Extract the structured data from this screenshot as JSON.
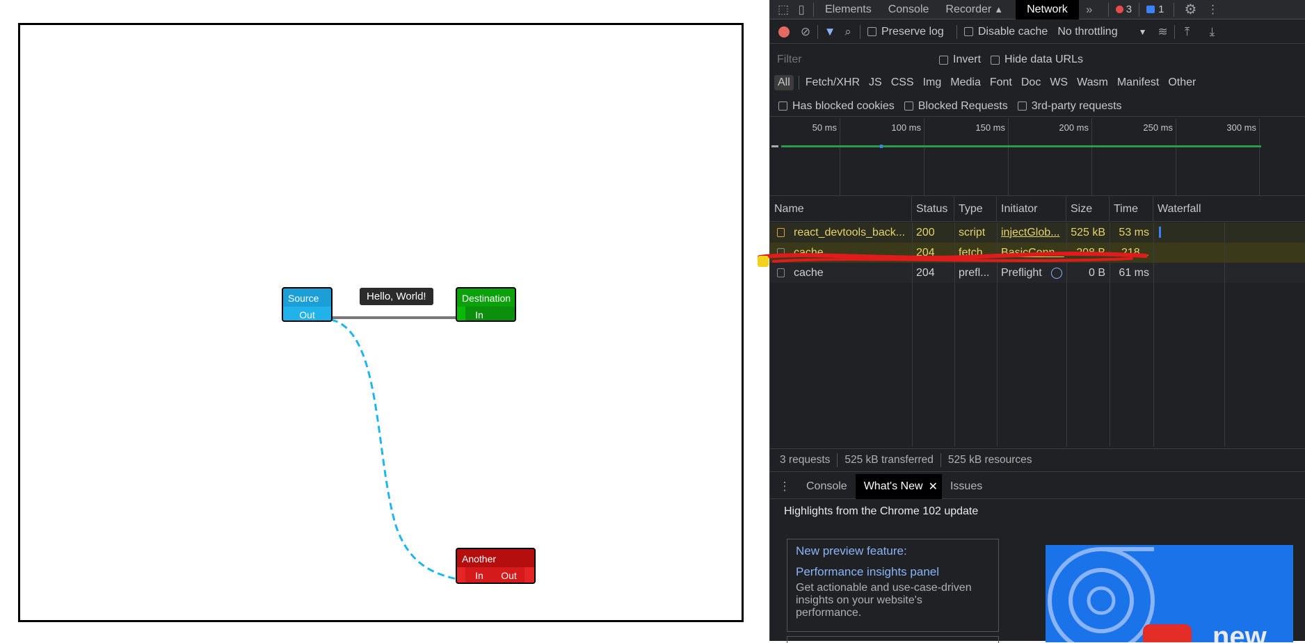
{
  "graph": {
    "nodes": {
      "source": {
        "title": "Source",
        "ports": [
          "Out"
        ],
        "color": "#1b9fd6"
      },
      "destination": {
        "title": "Destination",
        "ports": [
          "In"
        ],
        "color": "#0aa10a"
      },
      "another": {
        "title": "Another",
        "ports": [
          "In",
          "Out"
        ],
        "color": "#d41a1a"
      }
    },
    "link_label": "Hello, World!"
  },
  "devtools": {
    "tabs": [
      "Elements",
      "Console",
      "Recorder",
      "Network"
    ],
    "active_tab": "Network",
    "error_count": "3",
    "message_count": "1",
    "toolbar": {
      "preserve_log": "Preserve log",
      "disable_cache": "Disable cache",
      "throttling": "No throttling"
    },
    "filter": {
      "placeholder": "Filter",
      "invert": "Invert",
      "hide_data_urls": "Hide data URLs",
      "types": [
        "All",
        "Fetch/XHR",
        "JS",
        "CSS",
        "Img",
        "Media",
        "Font",
        "Doc",
        "WS",
        "Wasm",
        "Manifest",
        "Other"
      ],
      "has_blocked_cookies": "Has blocked cookies",
      "blocked_requests": "Blocked Requests",
      "third_party": "3rd-party requests"
    },
    "timeline_ticks": [
      "50 ms",
      "100 ms",
      "150 ms",
      "200 ms",
      "250 ms",
      "300 ms"
    ],
    "columns": [
      "Name",
      "Status",
      "Type",
      "Initiator",
      "Size",
      "Time",
      "Waterfall"
    ],
    "rows": [
      {
        "name": "react_devtools_back...",
        "status": "200",
        "type": "script",
        "initiator": "injectGlob...",
        "size": "525 kB",
        "time": "53 ms"
      },
      {
        "name": "cache",
        "status": "204",
        "type": "fetch",
        "initiator": "BasicConn...",
        "size": "208 B",
        "time": "218..."
      },
      {
        "name": "cache",
        "status": "204",
        "type": "prefl...",
        "initiator": "Preflight",
        "size": "0 B",
        "time": "61 ms"
      }
    ],
    "summary": {
      "requests": "3 requests",
      "transferred": "525 kB transferred",
      "resources": "525 kB resources"
    },
    "drawer": {
      "tabs": [
        "Console",
        "What's New",
        "Issues"
      ],
      "active_tab": "What's New",
      "heading": "Highlights from the Chrome 102 update",
      "card_kicker": "New preview feature:",
      "card_title": "Performance insights panel",
      "card_body": "Get actionable and use-case-driven insights on your website's performance.",
      "video_word": "new"
    }
  }
}
